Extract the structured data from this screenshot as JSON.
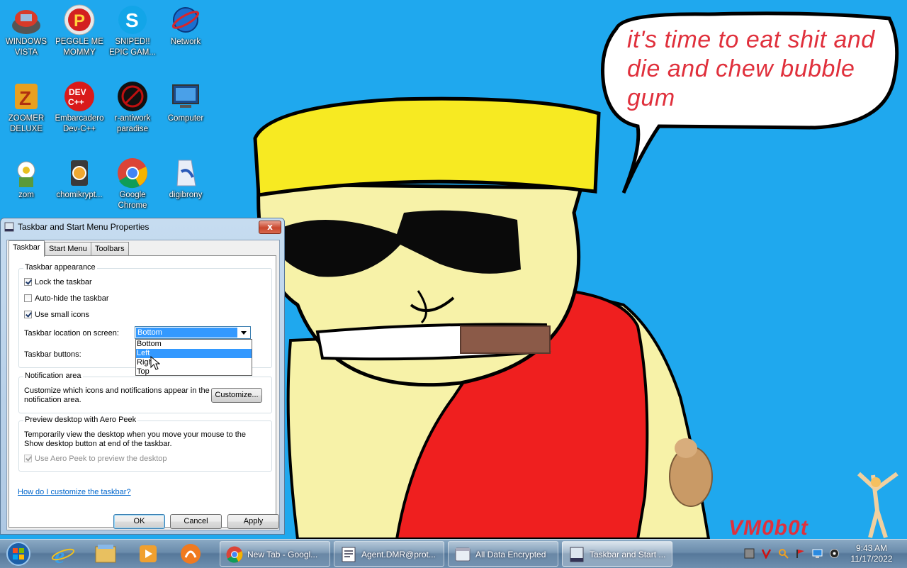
{
  "wallpaper": {
    "speech_bubble_text": "it's time to eat shit and die and chew bubble gum",
    "signature": "VM0b0t"
  },
  "desktop_icons": [
    {
      "label": "WINDOWS VISTA",
      "icon": "windows-vista-icon"
    },
    {
      "label": "PEGGLE ME MOMMY",
      "icon": "peggle-icon"
    },
    {
      "label": "SNIPED!! EPIC GAM...",
      "icon": "skype-icon"
    },
    {
      "label": "Network",
      "icon": "network-icon"
    },
    {
      "label": "ZOOMER DELUXE",
      "icon": "zoomer-icon"
    },
    {
      "label": "Embarcadero Dev-C++",
      "icon": "dev-cpp-icon"
    },
    {
      "label": "r-antiwork paradise",
      "icon": "antiwork-icon"
    },
    {
      "label": "Computer",
      "icon": "computer-icon"
    },
    {
      "label": "zom",
      "icon": "zom-icon"
    },
    {
      "label": "chomikrypt...",
      "icon": "chomikrypt-icon"
    },
    {
      "label": "Google Chrome",
      "icon": "chrome-icon"
    },
    {
      "label": "digibrony",
      "icon": "digibrony-icon"
    }
  ],
  "dialog": {
    "title": "Taskbar and Start Menu Properties",
    "close_label": "x",
    "tabs": [
      {
        "label": "Taskbar",
        "active": true
      },
      {
        "label": "Start Menu",
        "active": false
      },
      {
        "label": "Toolbars",
        "active": false
      }
    ],
    "appearance": {
      "group_title": "Taskbar appearance",
      "lock_label": "Lock the taskbar",
      "lock_checked": true,
      "autohide_label": "Auto-hide the taskbar",
      "autohide_checked": false,
      "small_icons_label": "Use small icons",
      "small_icons_checked": true,
      "location_label": "Taskbar location on screen:",
      "location_value": "Bottom",
      "location_options": [
        "Bottom",
        "Left",
        "Right",
        "Top"
      ],
      "location_highlighted": "Left",
      "buttons_label": "Taskbar buttons:"
    },
    "notification": {
      "group_title": "Notification area",
      "description": "Customize which icons and notifications appear in the notification area.",
      "customize_label": "Customize..."
    },
    "aero_peek": {
      "group_title": "Preview desktop with Aero Peek",
      "description": "Temporarily view the desktop when you move your mouse to the Show desktop button at end of the taskbar.",
      "checkbox_label": "Use Aero Peek to preview the desktop",
      "checked": true,
      "disabled": true
    },
    "help_link": "How do I customize the taskbar?",
    "ok_label": "OK",
    "cancel_label": "Cancel",
    "apply_label": "Apply"
  },
  "taskbar": {
    "pinned": [
      "internet-explorer-icon",
      "file-explorer-icon",
      "media-player-icon",
      "uc-browser-icon"
    ],
    "tasks": [
      {
        "label": "New Tab - Googl...",
        "icon": "chrome-icon",
        "active": false
      },
      {
        "label": "Agent.DMR@prot...",
        "icon": "notepad-icon",
        "active": false
      },
      {
        "label": "All Data Encrypted",
        "icon": "window-icon",
        "active": false
      },
      {
        "label": "Taskbar and Start ...",
        "icon": "taskbar-props-icon",
        "active": true
      }
    ],
    "clock_time": "9:43 AM",
    "clock_date": "11/17/2022",
    "accent": "#1fa8ee"
  }
}
